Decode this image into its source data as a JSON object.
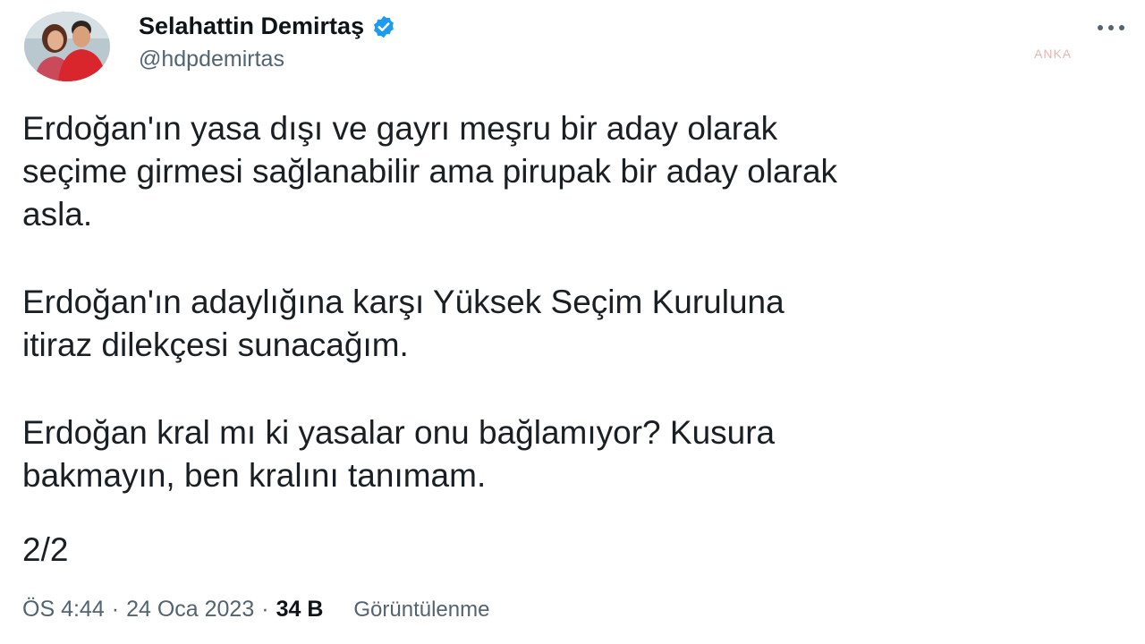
{
  "author": {
    "name": "Selahattin Demirtaş",
    "handle": "@hdpdemirtas",
    "verified": true,
    "verified_color": "#1d9bf0"
  },
  "watermark": "ANKA",
  "tweet": {
    "paragraphs": [
      "Erdoğan'ın yasa dışı ve gayrı meşru bir aday olarak\nseçime girmesi sağlanabilir ama pirupak bir aday olarak\nasla.",
      "Erdoğan'ın adaylığına karşı Yüksek Seçim Kuruluna\nitiraz dilekçesi sunacağım.",
      "Erdoğan kral mı ki yasalar onu bağlamıyor? Kusura\nbakmayın, ben kralını tanımam."
    ],
    "thread_position": "2/2"
  },
  "meta": {
    "time": "ÖS 4:44",
    "separator": "·",
    "date": "24 Oca 2023",
    "views_count": "34 B",
    "views_label": "Görüntülenme"
  },
  "icons": {
    "avatar": "profile-photo",
    "verified": "verified-badge-icon",
    "more": "more-options-icon"
  }
}
